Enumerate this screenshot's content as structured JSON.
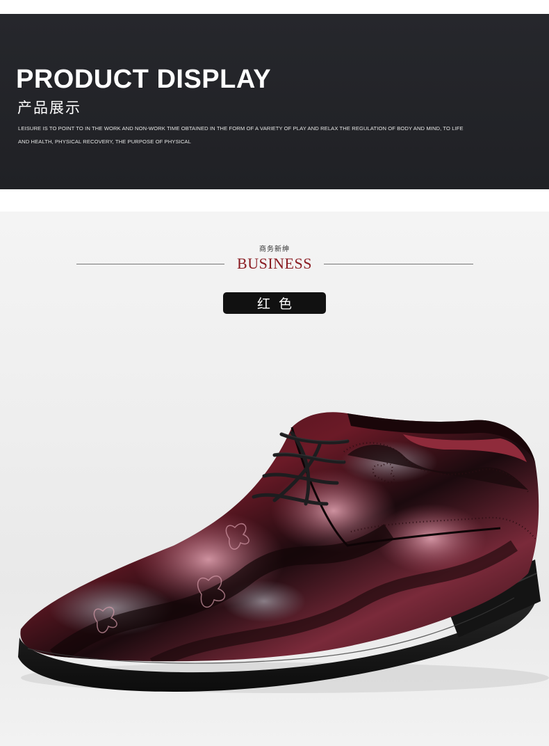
{
  "banner": {
    "title": "PRODUCT DISPLAY",
    "subtitle": "产品展示",
    "description_line1": "LEISURE IS TO POINT TO IN THE WORK AND NON-WORK TIME OBTAINED IN THE FORM OF A VARIETY OF PLAY AND RELAX THE REGULATION OF BODY AND MIND, TO LIFE",
    "description_line2": "AND HEALTH, PHYSICAL RECOVERY, THE PURPOSE OF PHYSICAL"
  },
  "showcase": {
    "category_cn": "商务新绅",
    "category_en": "BUSINESS",
    "color_label": "红色",
    "accent_color": "#8a1c22",
    "product_image": "red-patent-leather-oxford-shoe"
  }
}
